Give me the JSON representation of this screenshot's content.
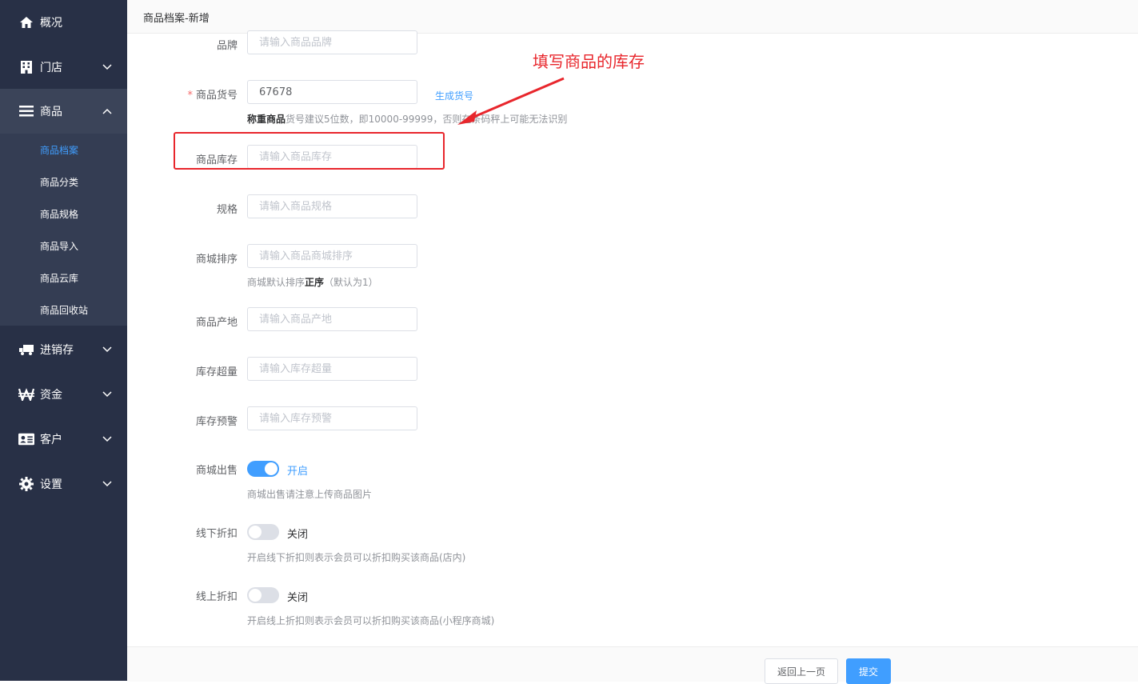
{
  "sidebar": {
    "items": [
      {
        "label": "概况",
        "icon": "home-icon"
      },
      {
        "label": "门店",
        "icon": "building-icon"
      },
      {
        "label": "商品",
        "icon": "list-icon"
      },
      {
        "label": "进销存",
        "icon": "truck-icon"
      },
      {
        "label": "资金",
        "icon": "won-icon"
      },
      {
        "label": "客户",
        "icon": "id-card-icon"
      },
      {
        "label": "设置",
        "icon": "gear-icon"
      }
    ],
    "submenu": [
      "商品档案",
      "商品分类",
      "商品规格",
      "商品导入",
      "商品云库",
      "商品回收站"
    ]
  },
  "header": {
    "title": "商品档案-新增"
  },
  "form": {
    "brand": {
      "label": "品牌",
      "placeholder": "请输入商品品牌"
    },
    "sku": {
      "required_mark": "*",
      "label": "商品货号",
      "value": "67678",
      "generate_link": "生成货号",
      "hint_bold": "称重商品",
      "hint_rest": "货号建议5位数，即10000-99999，否则在",
      "hint_tail": "条码秤上可能无法识别"
    },
    "stock": {
      "label": "商品库存",
      "placeholder": "请输入商品库存"
    },
    "spec": {
      "label": "规格",
      "placeholder": "请输入商品规格"
    },
    "mall_sort": {
      "label": "商城排序",
      "placeholder": "请输入商品商城排序",
      "hint_a": "商城默认排序",
      "hint_bold": "正序",
      "hint_b": "（默认为1）"
    },
    "origin": {
      "label": "商品产地",
      "placeholder": "请输入商品产地"
    },
    "overstock": {
      "label": "库存超量",
      "placeholder": "请输入库存超量"
    },
    "stock_alert": {
      "label": "库存预警",
      "placeholder": "请输入库存预警"
    },
    "mall_sale": {
      "label": "商城出售",
      "state": "开启",
      "hint": "商城出售请注意上传商品图片"
    },
    "offline_discount": {
      "label": "线下折扣",
      "state": "关闭",
      "hint": "开启线下折扣则表示会员可以折扣购买该商品(店内)"
    },
    "online_discount": {
      "label": "线上折扣",
      "state": "关闭",
      "hint": "开启线上折扣则表示会员可以折扣购买该商品(小程序商城)"
    }
  },
  "annotation": {
    "text": "填写商品的库存"
  },
  "footer": {
    "back_label": "返回上一页",
    "submit_label": "提交"
  },
  "colors": {
    "primary": "#409eff",
    "sidebar": "#283046",
    "annotation": "#e8262c"
  }
}
